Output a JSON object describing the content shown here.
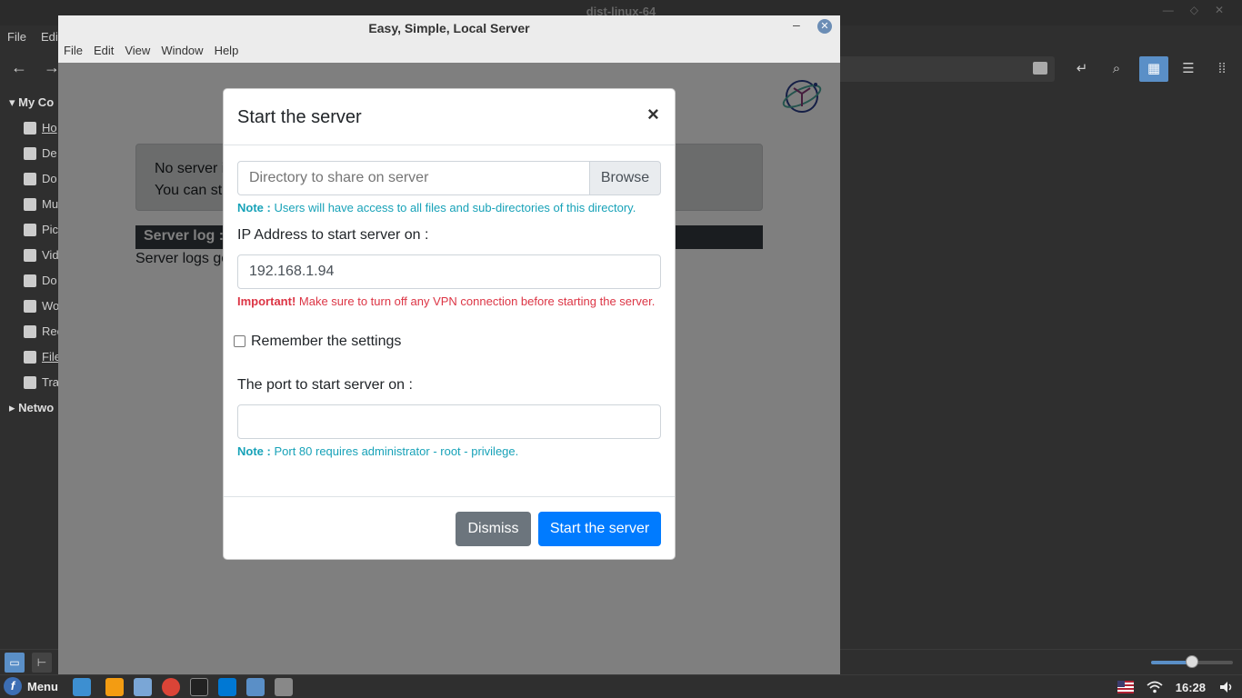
{
  "file_manager": {
    "title": "dist-linux-64",
    "menus": [
      "File",
      "Edit"
    ],
    "sidebar": {
      "my_computer": "My Co",
      "items": [
        "Ho",
        "De",
        "Do",
        "Mu",
        "Pic",
        "Vid",
        "Do",
        "Wo",
        "Rec",
        "File",
        "Tra"
      ],
      "network": "Netwo"
    }
  },
  "app": {
    "title": "Easy, Simple, Local Server",
    "menus": [
      "File",
      "Edit",
      "View",
      "Window",
      "Help"
    ],
    "alert_line1": "No server i",
    "alert_line2": "You can st",
    "log_header": "Server log :",
    "log_text": "Server logs go"
  },
  "modal": {
    "title": "Start the server",
    "close_symbol": "×",
    "directory_placeholder": "Directory to share on server",
    "browse_label": "Browse",
    "note1_label": "Note :",
    "note1_text": "Users will have access to all files and sub-directories of this directory.",
    "ip_label": "IP Address to start server on :",
    "ip_value": "192.168.1.94",
    "important_label": "Important!",
    "important_text": "Make sure to turn off any VPN connection before starting the server.",
    "remember_label": "Remember the settings",
    "remember_checked": false,
    "port_label": "The port to start server on :",
    "port_value": "",
    "note2_label": "Note :",
    "note2_text": "Port 80 requires administrator - root - privilege.",
    "dismiss_label": "Dismiss",
    "start_label": "Start the server"
  },
  "taskbar": {
    "menu_label": "Menu",
    "clock": "16:28"
  },
  "colors": {
    "primary": "#007bff",
    "secondary": "#6c757d",
    "info": "#17a2b8",
    "danger": "#dc3545",
    "fm_accent": "#5a8fc7"
  },
  "zoom_level": 0.5
}
